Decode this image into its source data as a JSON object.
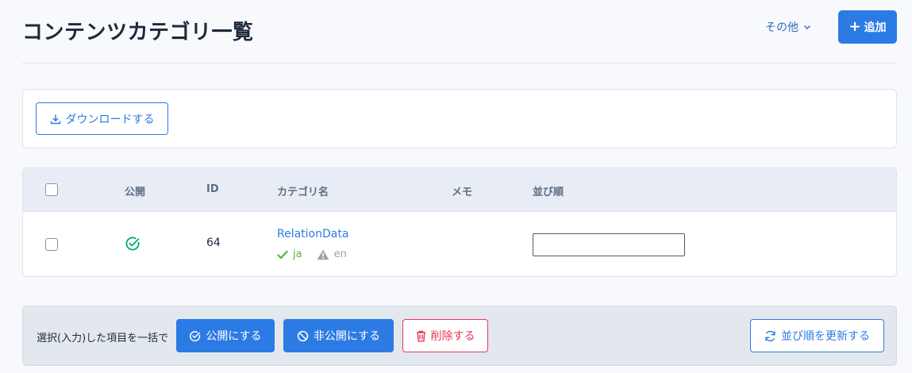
{
  "header": {
    "title": "コンテンツカテゴリ一覧",
    "other_menu_label": "その他",
    "add_label": "追加"
  },
  "download": {
    "label": "ダウンロードする"
  },
  "table": {
    "columns": [
      "公開",
      "ID",
      "カテゴリ名",
      "メモ",
      "並び順"
    ],
    "rows": [
      {
        "id": "64",
        "category_name": "RelationData",
        "langs": [
          "ja",
          "en"
        ],
        "published": true,
        "memo": "",
        "order": ""
      }
    ]
  },
  "bulk": {
    "label": "選択(入力)した項目を一括で",
    "publish_label": "公開にする",
    "unpublish_label": "非公開にする",
    "delete_label": "削除する",
    "update_order_label": "並び順を更新する"
  },
  "colors": {
    "primary": "#2c7be5",
    "danger": "#e63757",
    "success": "#00a86b",
    "warning_gray": "#9aa3ae"
  }
}
